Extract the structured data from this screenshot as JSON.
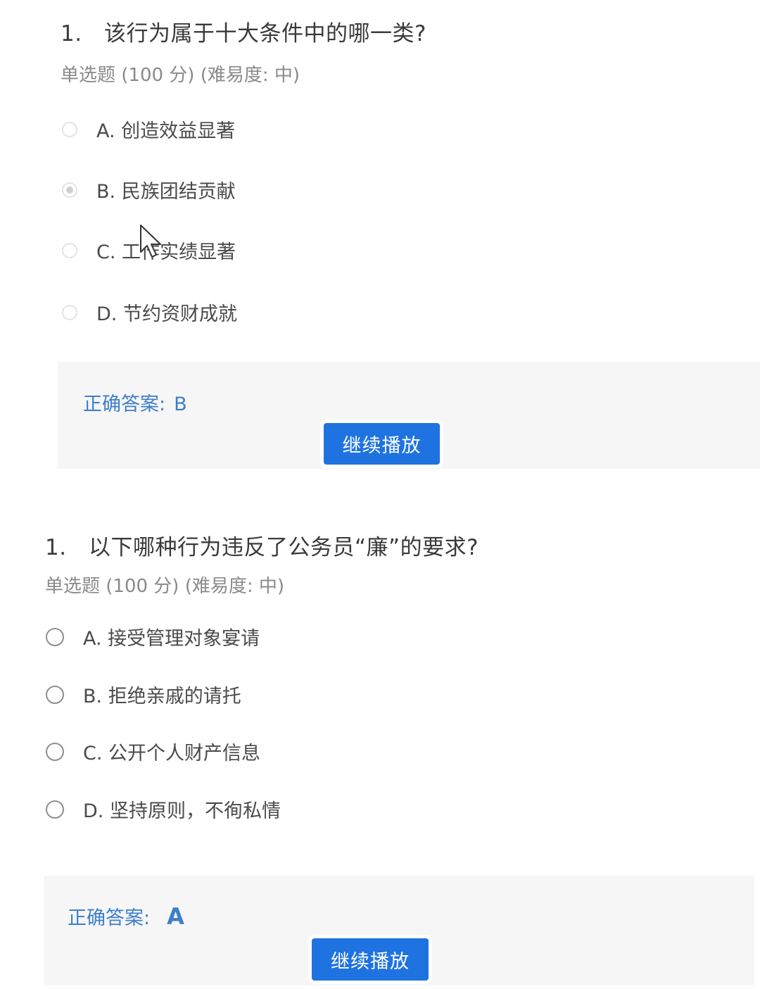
{
  "questions": [
    {
      "number": "1.",
      "title": "该行为属于十大条件中的哪一类?",
      "meta": "单选题 (100 分) (难易度: 中)",
      "options": [
        {
          "label": "A. 创造效益显著",
          "checked": false
        },
        {
          "label": "B. 民族团结贡献",
          "checked": true
        },
        {
          "label": "C. 工作实绩显著",
          "checked": false
        },
        {
          "label": "D. 节约资财成就",
          "checked": false
        }
      ],
      "answer_label": "正确答案:",
      "answer_value": "B",
      "continue_button": "继续播放"
    },
    {
      "number": "1.",
      "title": "以下哪种行为违反了公务员“廉”的要求?",
      "meta": "单选题 (100 分) (难易度: 中)",
      "options": [
        {
          "label": "A. 接受管理对象宴请",
          "checked": false
        },
        {
          "label": "B. 拒绝亲戚的请托",
          "checked": false
        },
        {
          "label": "C. 公开个人财产信息",
          "checked": false
        },
        {
          "label": "D. 坚持原则，不徇私情",
          "checked": false
        }
      ],
      "answer_label": "正确答案:",
      "answer_value": "A",
      "continue_button": "继续播放"
    }
  ],
  "icons": {
    "cursor": "mouse-pointer-icon",
    "radio": "radio-button-icon"
  },
  "colors": {
    "answer_text": "#3d7fc9",
    "button_bg": "#1e73e0",
    "answer_panel_bg": "#f6f6f7"
  }
}
